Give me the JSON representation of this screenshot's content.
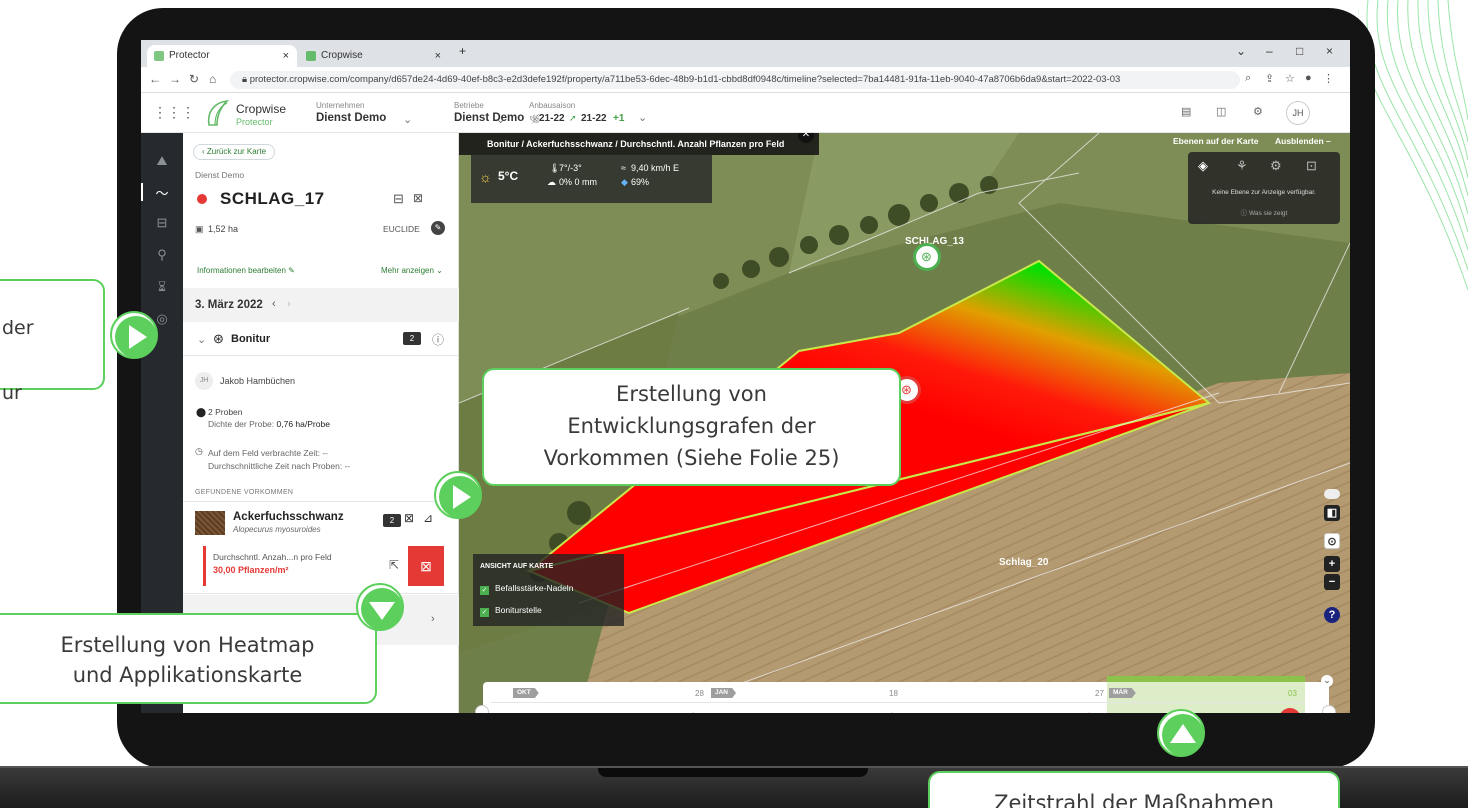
{
  "browser": {
    "tabs": [
      {
        "label": "Protector"
      },
      {
        "label": "Cropwise"
      }
    ],
    "new_tab": "+",
    "url": "protector.cropwise.com/company/d657de24-4d69-40ef-b8c3-e2d3defe192f/property/a711be53-6dec-48b9-b1d1-cbbd8df0948c/timeline?selected=7ba14481-91fa-11eb-9040-47a8706b6da9&start=2022-03-03"
  },
  "header": {
    "brand": "Cropwise",
    "brand_sub": "Protector",
    "company_label": "Unternehmen",
    "company_value": "Dienst Demo",
    "farm_label": "Betriebe",
    "farm_value": "Dienst Demo",
    "season_label": "Anbausaison",
    "season_a": "21-22",
    "season_b": "21-22",
    "season_more": "+1",
    "user_initials": "JH"
  },
  "panel": {
    "back_label": "Zurück zur Karte",
    "farm_name": "Dienst Demo",
    "field_name": "SCHLAG_17",
    "area": "1,52 ha",
    "variety": "EUCLIDE",
    "edit_info": "Informationen bearbeiten",
    "show_more": "Mehr anzeigen",
    "date": "3. März 2022",
    "section": "Bonitur",
    "section_count": "2",
    "user_initials": "JH",
    "user_name": "Jakob Hambüchen",
    "samples": "2 Proben",
    "sample_density_label": "Dichte der Probe:",
    "sample_density_value": "0,76 ha/Probe",
    "time_field": "Auf dem Feld verbrachte Zeit: --",
    "time_avg": "Durchschnittliche Zeit nach Proben: --",
    "found_header": "GEFUNDENE VORKOMMEN",
    "pest_name": "Ackerfuchsschwanz",
    "pest_latin": "Alopecurus myosuroides",
    "pest_count": "2",
    "metric_label": "Durchschntl. Anzah...n pro Feld",
    "metric_value": "30,00 Pflanzen/m²"
  },
  "map": {
    "breadcrumb": "Bonitur / Ackerfuchsschwanz / Durchschntl. Anzahl Pflanzen pro Feld",
    "weather": {
      "temp": "5°C",
      "minmax": "7°/-3°",
      "rain": "0% 0 mm",
      "wind": "9,40 km/h E",
      "humidity": "69%"
    },
    "layers_title": "Ebenen auf der Karte",
    "layers_hide": "Ausblenden –",
    "layers_empty": "Keine Ebene zur Anzeige verfügbar.",
    "layers_help": "Was sie zeigt",
    "field_label_13": "SCHLAG_13",
    "field_label_20": "Schlag_20",
    "view_title": "ANSICHT AUF KARTE",
    "view_opt1": "Befallsstärke-Nadeln",
    "view_opt2": "Boniturstelle",
    "zoom_in": "+",
    "zoom_out": "−",
    "help": "?"
  },
  "timeline": {
    "months": [
      {
        "label": "OKT"
      },
      {
        "label": "JAN"
      },
      {
        "label": "MÄR"
      }
    ],
    "days": [
      "28",
      "18",
      "27",
      "03"
    ]
  },
  "callouts": {
    "left_top": "der\nur",
    "center": "Erstellung von\nEntwicklungsgrafen der\nVorkommen (Siehe Folie 25)",
    "bottom_left": "Erstellung von Heatmap\nund Applikationskarte",
    "bottom_right": "Zeitstrahl der Maßnahmen"
  },
  "colors": {
    "accent": "#5ccf5c",
    "alert": "#e53935",
    "brand": "#2e7d32"
  }
}
